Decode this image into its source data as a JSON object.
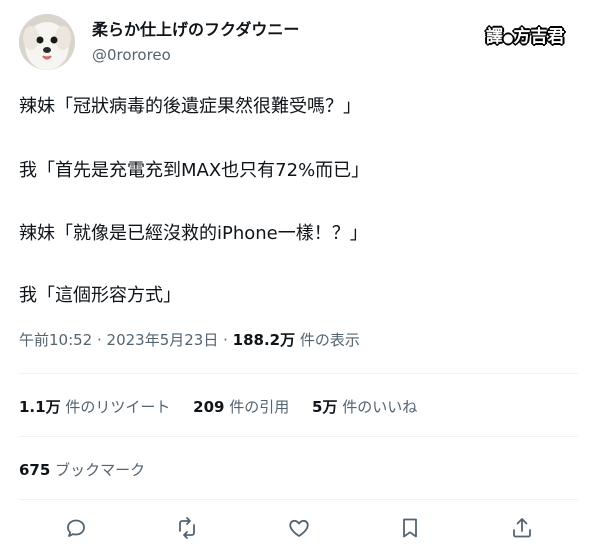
{
  "author": {
    "display_name": "柔らか仕上げのフクダウニー",
    "handle": "@0rororeo"
  },
  "watermark": {
    "left": "譯",
    "dot": "●",
    "right": "方吉君"
  },
  "tweet": {
    "lines": [
      "辣妹「冠狀病毒的後遺症果然很難受嗎？」",
      "我「首先是充電充到MAX也只有72%而已」",
      "辣妹「就像是已經沒救的iPhone一樣！？」",
      "我「這個形容方式」"
    ]
  },
  "meta": {
    "time": "午前10:52",
    "sep1": " · ",
    "date": "2023年5月23日",
    "sep2": " · ",
    "views_count": "188.2万",
    "views_label": " 件の表示"
  },
  "stats": {
    "retweets_count": "1.1万",
    "retweets_label": " 件のリツイート",
    "quotes_count": "209",
    "quotes_label": " 件の引用",
    "likes_count": "5万",
    "likes_label": " 件のいいね"
  },
  "bookmarks": {
    "count": "675",
    "label": " ブックマーク"
  },
  "actions": {
    "reply_icon": "reply-icon",
    "retweet_icon": "retweet-icon",
    "like_icon": "heart-icon",
    "bookmark_icon": "bookmark-icon",
    "share_icon": "share-icon"
  }
}
